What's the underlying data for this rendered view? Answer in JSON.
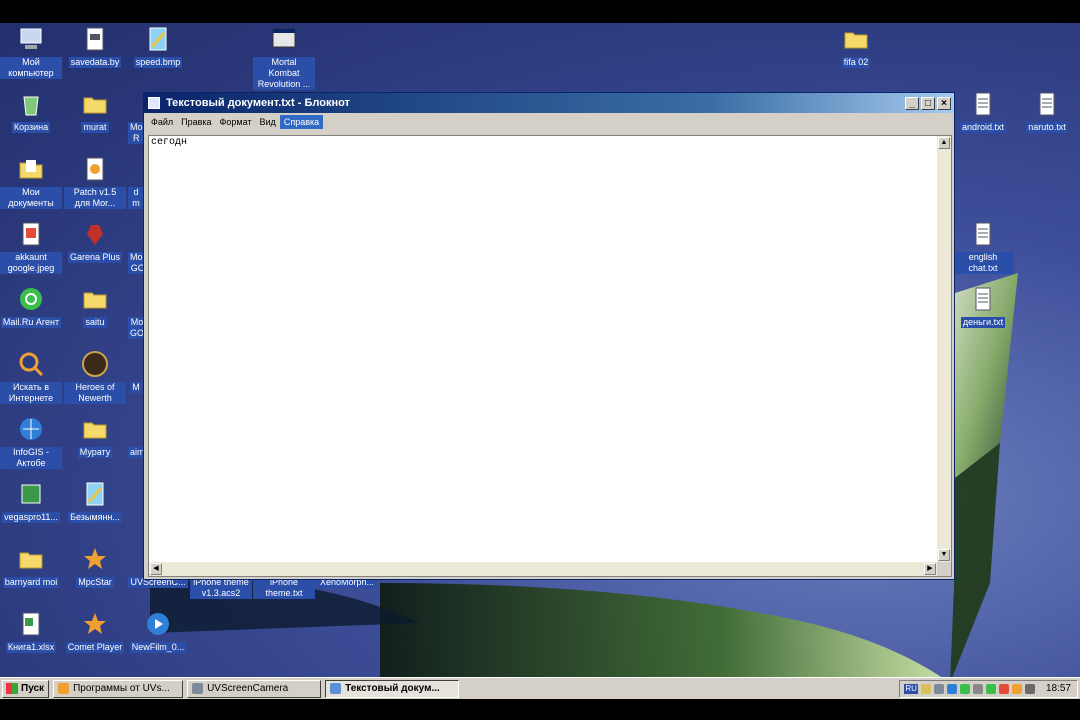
{
  "desktop": {
    "icons": [
      {
        "label": "Мой компьютер",
        "type": "computer-icon",
        "color": "#c9d8f0"
      },
      {
        "label": "savedata.by",
        "type": "file-icon",
        "color": "#ffffff"
      },
      {
        "label": "speed.bmp",
        "type": "image-file-icon",
        "color": "#8fd1f2"
      },
      {
        "label": "Mortal Kombat Revolution ...",
        "type": "program-window-icon",
        "color": "#e6e6e6"
      },
      {
        "label": "fifa 02",
        "type": "folder-icon",
        "color": "#f5d96b"
      },
      {
        "label": "Корзина",
        "type": "recycle-bin-icon",
        "color": "#7ec97a"
      },
      {
        "label": "murat",
        "type": "folder-icon",
        "color": "#f5d96b"
      },
      {
        "label": "android.txt",
        "type": "text-file-icon",
        "color": "#ffffff"
      },
      {
        "label": "naruto.txt",
        "type": "text-file-icon",
        "color": "#ffffff"
      },
      {
        "label": "Мои документы",
        "type": "my-documents-icon",
        "color": "#f5d96b"
      },
      {
        "label": "Patch v1.5 для Mor...",
        "type": "patch-icon",
        "color": "#f0a030"
      },
      {
        "label": "akkaunt google.jpeg",
        "type": "image-file-icon",
        "color": "#e34b3a"
      },
      {
        "label": "Garena Plus",
        "type": "garena-icon",
        "color": "#c0302a"
      },
      {
        "label": "english chat.txt",
        "type": "text-file-icon",
        "color": "#ffffff"
      },
      {
        "label": "Mail.Ru Агент",
        "type": "mailru-agent-icon",
        "color": "#3cbf4a"
      },
      {
        "label": "saitu",
        "type": "folder-icon",
        "color": "#f5d96b"
      },
      {
        "label": "деньги.txt",
        "type": "text-file-icon",
        "color": "#ffffff"
      },
      {
        "label": "Искать в Интернете",
        "type": "search-internet-icon",
        "color": "#f0a030"
      },
      {
        "label": "Heroes of Newerth",
        "type": "hon-icon",
        "color": "#3a2a1a"
      },
      {
        "label": "InfoGIS - Актобе",
        "type": "infogis-icon",
        "color": "#2f7fd8"
      },
      {
        "label": "Мурату",
        "type": "folder-icon",
        "color": "#f5d96b"
      },
      {
        "label": "vegaspro11...",
        "type": "vegas-icon",
        "color": "#3a9a4a"
      },
      {
        "label": "Безымянн...",
        "type": "image-file-icon",
        "color": "#8fd1f2"
      },
      {
        "label": "barnyard moi",
        "type": "folder-icon",
        "color": "#f5d96b"
      },
      {
        "label": "MpcStar",
        "type": "mpcstar-icon",
        "color": "#f0a030"
      },
      {
        "label": "UVScreenC...",
        "type": "uvscreen-icon",
        "color": "#888888"
      },
      {
        "label": "iPhone theme v1.3.acs2",
        "type": "acs-file-icon",
        "color": "#333333"
      },
      {
        "label": "iPhone theme.txt",
        "type": "text-file-icon",
        "color": "#ffffff"
      },
      {
        "label": "XenoMorph...",
        "type": "text-file-icon",
        "color": "#ffffff"
      },
      {
        "label": "Книга1.xlsx",
        "type": "excel-file-icon",
        "color": "#3a9a4a"
      },
      {
        "label": "Comet Player",
        "type": "comet-player-icon",
        "color": "#f0a030"
      },
      {
        "label": "NewFilm_0...",
        "type": "avi-file-icon",
        "color": "#2f7fd8"
      }
    ],
    "partial_icons": [
      {
        "label": "Mo R",
        "type": "partial-icon"
      },
      {
        "label": "d m",
        "type": "partial-icon"
      },
      {
        "label": "Mor GO",
        "type": "partial-icon"
      },
      {
        "label": "Mo GO",
        "type": "partial-icon"
      },
      {
        "label": "M",
        "type": "partial-icon"
      },
      {
        "label": "aim",
        "type": "partial-icon"
      }
    ]
  },
  "window": {
    "title": "Текстовый документ.txt - Блокнот",
    "menu": [
      "Файл",
      "Правка",
      "Формат",
      "Вид",
      "Справка"
    ],
    "active_menu_index": 4,
    "content": "сегодн",
    "buttons": {
      "minimize": "_",
      "maximize": "□",
      "close": "×"
    }
  },
  "taskbar": {
    "start_label": "Пуск",
    "tasks": [
      {
        "label": "Программы от UVs...",
        "icon": "browser-icon",
        "color": "#f0a030",
        "active": false
      },
      {
        "label": "UVScreenCamera",
        "icon": "uvscreen-icon",
        "color": "#7d8a9a",
        "active": false
      },
      {
        "label": "Текстовый докум...",
        "icon": "notepad-icon",
        "color": "#5b8fd8",
        "active": true
      }
    ],
    "tray": {
      "lang": "RU",
      "clock": "18:57",
      "icons": [
        {
          "name": "tray-app-icon",
          "color": "#d8c05a"
        },
        {
          "name": "tray-volume-icon",
          "color": "#7d8a9a"
        },
        {
          "name": "tray-network-icon",
          "color": "#2f7fd8"
        },
        {
          "name": "tray-messenger-icon",
          "color": "#3cbf4a"
        },
        {
          "name": "tray-settings-icon",
          "color": "#888888"
        },
        {
          "name": "tray-agent-icon",
          "color": "#3cbf4a"
        },
        {
          "name": "tray-security-icon",
          "color": "#e34b3a"
        },
        {
          "name": "tray-update-icon",
          "color": "#f0a030"
        },
        {
          "name": "tray-display-icon",
          "color": "#6a6a6a"
        }
      ]
    }
  }
}
